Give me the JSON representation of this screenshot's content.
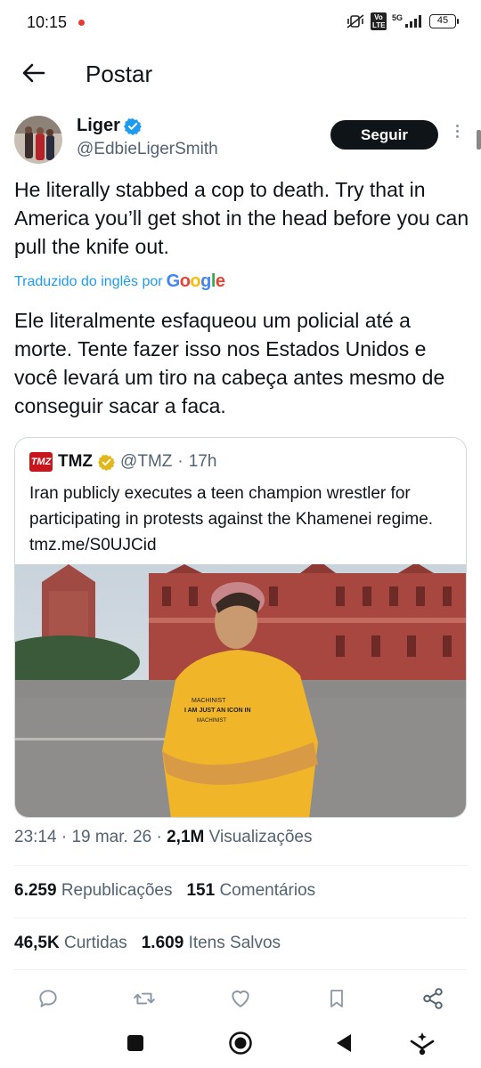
{
  "status_bar": {
    "time": "10:15",
    "network_badge": "Vo LTE",
    "network_type": "5G",
    "battery": "45"
  },
  "header": {
    "title": "Postar"
  },
  "author": {
    "name": "Liger",
    "handle": "@EdbieLigerSmith",
    "follow_label": "Seguir",
    "verified": true
  },
  "tweet": {
    "text": "He literally stabbed a cop to death. Try that in America you’ll get shot in the head before you can pull the knife out.",
    "translated_prefix": "Traduzido do inglês por",
    "translator_brand": "Google",
    "translation": "Ele literalmente esfaqueou um policial até a morte. Tente fazer isso nos Estados Unidos e você levará um tiro na cabeça antes mesmo de conseguir sacar a faca."
  },
  "quote": {
    "logo_text": "TMZ",
    "name": "TMZ",
    "handle": "@TMZ",
    "separator": "·",
    "time": "17h",
    "text": "Iran publicly executes a teen champion wrestler for participating in protests against the Khamenei regime. tmz.me/S0UJCid",
    "shirt_text_1": "MACHINIST",
    "shirt_text_2": "I AM JUST AN ICON IN",
    "shirt_text_3": "MACHINIST"
  },
  "meta": {
    "time": "23:14",
    "sep1": " · ",
    "date": "19 mar. 26",
    "sep2": " · ",
    "views_count": "2,1M",
    "views_label": "Visualizações"
  },
  "stats": {
    "reposts_count": "6.259",
    "reposts_label": "Republicações",
    "comments_count": "151",
    "comments_label": "Comentários",
    "likes_count": "46,5K",
    "likes_label": "Curtidas",
    "saves_count": "1.609",
    "saves_label": "Itens Salvos"
  },
  "colors": {
    "accent": "#1d9bf0",
    "text": "#0f1419",
    "muted": "#536471",
    "follow_bg": "#0f1419",
    "tmz_red": "#c7161d"
  },
  "icons": {
    "actions": [
      "reply-icon",
      "repost-icon",
      "like-icon",
      "bookmark-icon",
      "share-icon"
    ],
    "nav": [
      "recents-icon",
      "home-icon",
      "back-icon",
      "assistant-icon"
    ]
  }
}
